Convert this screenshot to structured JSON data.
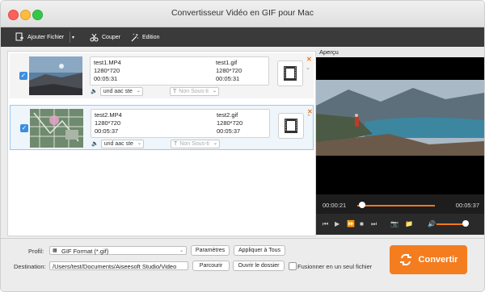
{
  "window": {
    "title": "Convertisseur Vidéo en GIF pour Mac"
  },
  "toolbar": {
    "add_file": "Ajouter Fichier",
    "cut": "Couper",
    "edit": "Edition"
  },
  "files": [
    {
      "src_name": "test1.MP4",
      "src_res": "1280*720",
      "src_dur": "00:05:31",
      "dst_name": "test1.gif",
      "dst_res": "1280*720",
      "dst_dur": "00:05:31",
      "audio": "und aac ste",
      "subtitle": "Non Sous-ti"
    },
    {
      "src_name": "test2.MP4",
      "src_res": "1280*720",
      "src_dur": "00:05:37",
      "dst_name": "test2.gif",
      "dst_res": "1280*720",
      "dst_dur": "00:05:37",
      "audio": "und aac ste",
      "subtitle": "Non Sous-ti"
    }
  ],
  "preview": {
    "label": "Aperçu",
    "current_time": "00:00:21",
    "total_time": "00:05:37",
    "progress": 0.06,
    "volume": 0.9
  },
  "bottom": {
    "profile_label": "Profil:",
    "profile_value": "GIF Format (*.gif)",
    "settings_btn": "Paramètres",
    "apply_all_btn": "Appliquer à Tous",
    "dest_label": "Destination:",
    "dest_value": "/Users/test/Documents/Aiseesoft Studio/Video",
    "browse_btn": "Parcourir",
    "open_folder_btn": "Ouvrir le dossier",
    "merge_label": "Fusionner en un seul fichier",
    "convert_btn": "Convertir"
  },
  "colors": {
    "accent": "#f47d20",
    "check": "#3b8fe0"
  }
}
